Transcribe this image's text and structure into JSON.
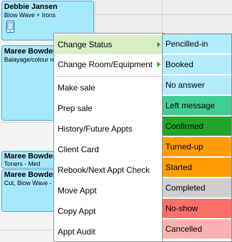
{
  "appointments": [
    {
      "name": "Debbie Jansen",
      "service": "Blow Wave + Irons",
      "has_phone_icon": true
    },
    {
      "name": "Maree Bowden",
      "service": "Balayage/colour refresh"
    },
    {
      "name": "Maree Bowden",
      "service": "Toners - Med"
    },
    {
      "name": "Maree Bowden",
      "service": "Cut, Blow Wave - Med"
    }
  ],
  "context_menu": {
    "items": [
      {
        "label": "Change Status",
        "has_submenu": true
      },
      {
        "label": "Change Room/Equipment",
        "has_submenu": true
      },
      {
        "label": "Make sale"
      },
      {
        "label": "Prep sale"
      },
      {
        "label": "History/Future Appts"
      },
      {
        "label": "Client Card"
      },
      {
        "label": "Rebook/Next Appt Check"
      },
      {
        "label": "Move Appt"
      },
      {
        "label": "Copy Appt"
      },
      {
        "label": "Appt Audit"
      }
    ]
  },
  "status_menu": {
    "items": [
      {
        "label": "Pencilled-in",
        "color": "#b3ecfb"
      },
      {
        "label": "Booked",
        "color": "#b3ecfb"
      },
      {
        "label": "No answer",
        "color": "#b3ecfb"
      },
      {
        "label": "Left message",
        "color": "#3fcf95"
      },
      {
        "label": "Confirmed",
        "color": "#23a52b"
      },
      {
        "label": "Turned-up",
        "color": "#ff9c08"
      },
      {
        "label": "Started",
        "color": "#ff9c08"
      },
      {
        "label": "Completed",
        "color": "#cfcfcf"
      },
      {
        "label": "No-show",
        "color": "#fb6f69"
      },
      {
        "label": "Cancelled",
        "color": "#fbb3b1"
      }
    ]
  },
  "colors": {
    "appointment_bg": "#a8e8fb",
    "appointment_border": "#4aa9d6",
    "menu_highlight": "#d8efc6",
    "submenu_arrow": "#4a9d2a"
  }
}
